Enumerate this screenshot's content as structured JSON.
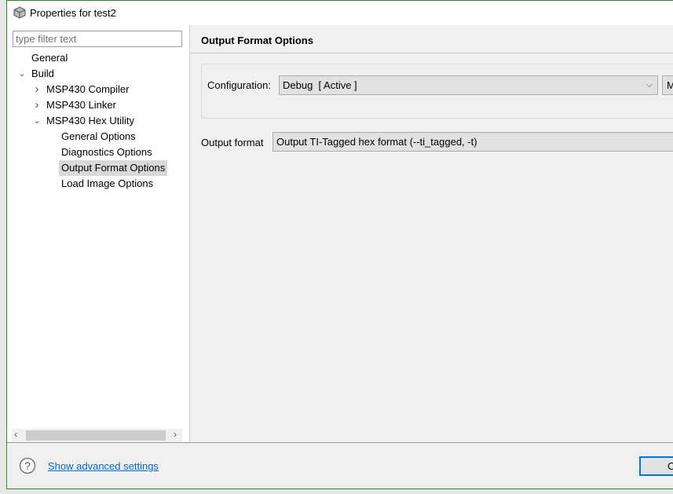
{
  "window": {
    "title": "Properties for test2",
    "icon": "cube-icon",
    "accent": "#2f8a2f"
  },
  "tree": {
    "filter_placeholder": "type filter text",
    "items": [
      {
        "label": "General",
        "level": 0,
        "expander": "none"
      },
      {
        "label": "Build",
        "level": 0,
        "expander": "expanded"
      },
      {
        "label": "MSP430 Compiler",
        "level": 1,
        "expander": "collapsed"
      },
      {
        "label": "MSP430 Linker",
        "level": 1,
        "expander": "collapsed"
      },
      {
        "label": "MSP430 Hex Utility",
        "level": 1,
        "expander": "expanded"
      },
      {
        "label": "General Options",
        "level": 2,
        "expander": "none"
      },
      {
        "label": "Diagnostics Options",
        "level": 2,
        "expander": "none"
      },
      {
        "label": "Output Format Options",
        "level": 2,
        "expander": "none",
        "selected": true
      },
      {
        "label": "Load Image Options",
        "level": 2,
        "expander": "none"
      }
    ]
  },
  "page": {
    "title": "Output Format Options",
    "config_label": "Configuration:",
    "config_value": "Debug  [ Active ]",
    "manage_button": "M",
    "output_format_label": "Output format",
    "output_format_value": "Output TI-Tagged hex format (--ti_tagged, -t)"
  },
  "footer": {
    "help_icon": "question-circle-icon",
    "advanced_link": "Show advanced settings",
    "button_label": "C"
  }
}
